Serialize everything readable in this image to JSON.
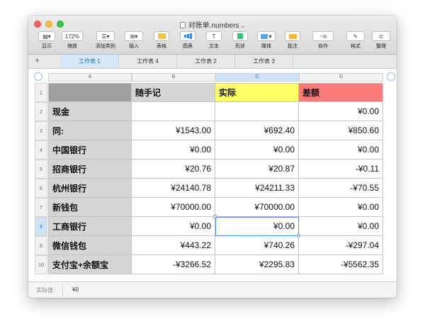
{
  "window": {
    "title": "对账单.numbers"
  },
  "toolbar": [
    {
      "label": "显示",
      "icon": "sidebar-icon",
      "text": ""
    },
    {
      "label": "缩放",
      "icon": "zoom-icon",
      "text": "172%"
    },
    {
      "label": "添加类别",
      "icon": "list-icon",
      "text": ""
    },
    {
      "label": "插入",
      "icon": "insert-icon",
      "text": ""
    },
    {
      "label": "表格",
      "icon": "table-icon",
      "text": ""
    },
    {
      "label": "图表",
      "icon": "chart-icon",
      "text": ""
    },
    {
      "label": "文本",
      "icon": "text-icon",
      "text": "T"
    },
    {
      "label": "形状",
      "icon": "shape-icon",
      "text": ""
    },
    {
      "label": "媒体",
      "icon": "media-icon",
      "text": ""
    },
    {
      "label": "批注",
      "icon": "comment-icon",
      "text": ""
    },
    {
      "label": "协作",
      "icon": "collaborate-icon",
      "text": ""
    },
    {
      "label": "格式",
      "icon": "format-icon",
      "text": ""
    },
    {
      "label": "整理",
      "icon": "organize-icon",
      "text": ""
    }
  ],
  "sheet_tabs": [
    {
      "label": "工作表 1",
      "active": true
    },
    {
      "label": "工作表 4",
      "active": false
    },
    {
      "label": "工作表 2",
      "active": false
    },
    {
      "label": "工作表 3",
      "active": false
    }
  ],
  "columns": [
    "A",
    "B",
    "C",
    "D"
  ],
  "selected_column": "C",
  "selected_row": "8",
  "table": {
    "header": [
      "",
      "随手记",
      "实际",
      "差额"
    ],
    "header_colors": [
      "#9e9e9e",
      "#d6d6d6",
      "#ffff66",
      "#ff7b7b"
    ],
    "rows": [
      {
        "num": "2",
        "cells": [
          "现金",
          "",
          "",
          "¥0.00"
        ]
      },
      {
        "num": "3",
        "cells": [
          "同:",
          "¥1543.00",
          "¥692.40",
          "¥850.60"
        ]
      },
      {
        "num": "4",
        "cells": [
          "中国银行",
          "¥0.00",
          "¥0.00",
          "¥0.00"
        ]
      },
      {
        "num": "5",
        "cells": [
          "招商银行",
          "¥20.76",
          "¥20.87",
          "-¥0.11"
        ]
      },
      {
        "num": "6",
        "cells": [
          "杭州银行",
          "¥24140.78",
          "¥24211.33",
          "-¥70.55"
        ]
      },
      {
        "num": "7",
        "cells": [
          "新钱包",
          "¥70000.00",
          "¥70000.00",
          "¥0.00"
        ]
      },
      {
        "num": "8",
        "cells": [
          "工商银行",
          "¥0.00",
          "¥0.00",
          "¥0.00"
        ]
      },
      {
        "num": "9",
        "cells": [
          "微信钱包",
          "¥443.22",
          "¥740.26",
          "-¥297.04"
        ]
      },
      {
        "num": "10",
        "cells": [
          "支付宝+余额宝",
          "-¥3266.52",
          "¥2295.83",
          "-¥5562.35"
        ]
      }
    ]
  },
  "status": {
    "label": "实际值",
    "value": "¥0"
  }
}
